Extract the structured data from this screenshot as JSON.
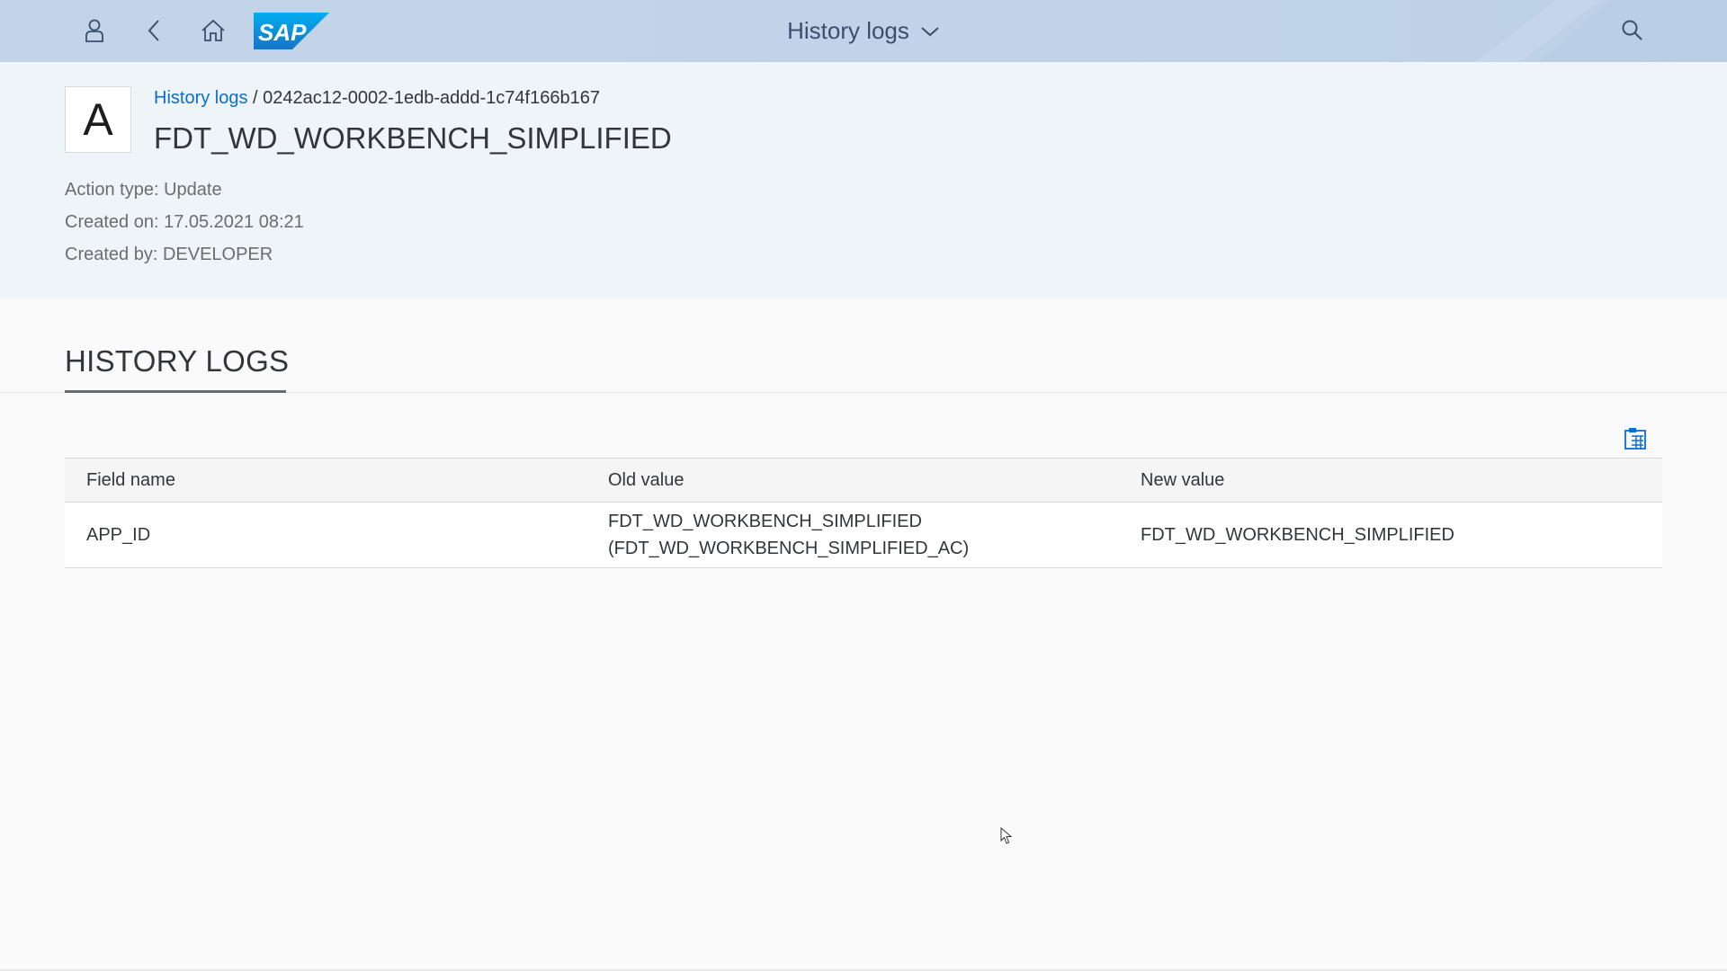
{
  "shell": {
    "title": "History logs",
    "logo_text": "SAP",
    "icons": {
      "user": "user-icon",
      "back": "back-arrow-icon",
      "home": "home-icon",
      "title_dropdown": "chevron-down-icon",
      "search": "search-icon"
    }
  },
  "header": {
    "avatar_initial": "A",
    "breadcrumb": {
      "link": "History logs",
      "separator": "/",
      "current": "0242ac12-0002-1edb-addd-1c74f166b167"
    },
    "title": "FDT_WD_WORKBENCH_SIMPLIFIED",
    "attributes": [
      {
        "label": "Action type:",
        "value": "Update"
      },
      {
        "label": "Created on:",
        "value": "17.05.2021 08:21"
      },
      {
        "label": "Created by:",
        "value": "DEVELOPER"
      }
    ]
  },
  "section": {
    "title": "HISTORY LOGS",
    "export_icon": "export-spreadsheet-icon"
  },
  "table": {
    "columns": [
      "Field name",
      "Old value",
      "New value"
    ],
    "rows": [
      {
        "field_name": "APP_ID",
        "old_value": [
          "FDT_WD_WORKBENCH_SIMPLIFIED",
          "(FDT_WD_WORKBENCH_SIMPLIFIED_AC)"
        ],
        "new_value": "FDT_WD_WORKBENCH_SIMPLIFIED"
      }
    ]
  },
  "colors": {
    "shell_bg": "#c0d3e9",
    "header_bg": "#eff4f9",
    "link": "#0a6ed1",
    "sap_blue": "#1a8fd8"
  }
}
